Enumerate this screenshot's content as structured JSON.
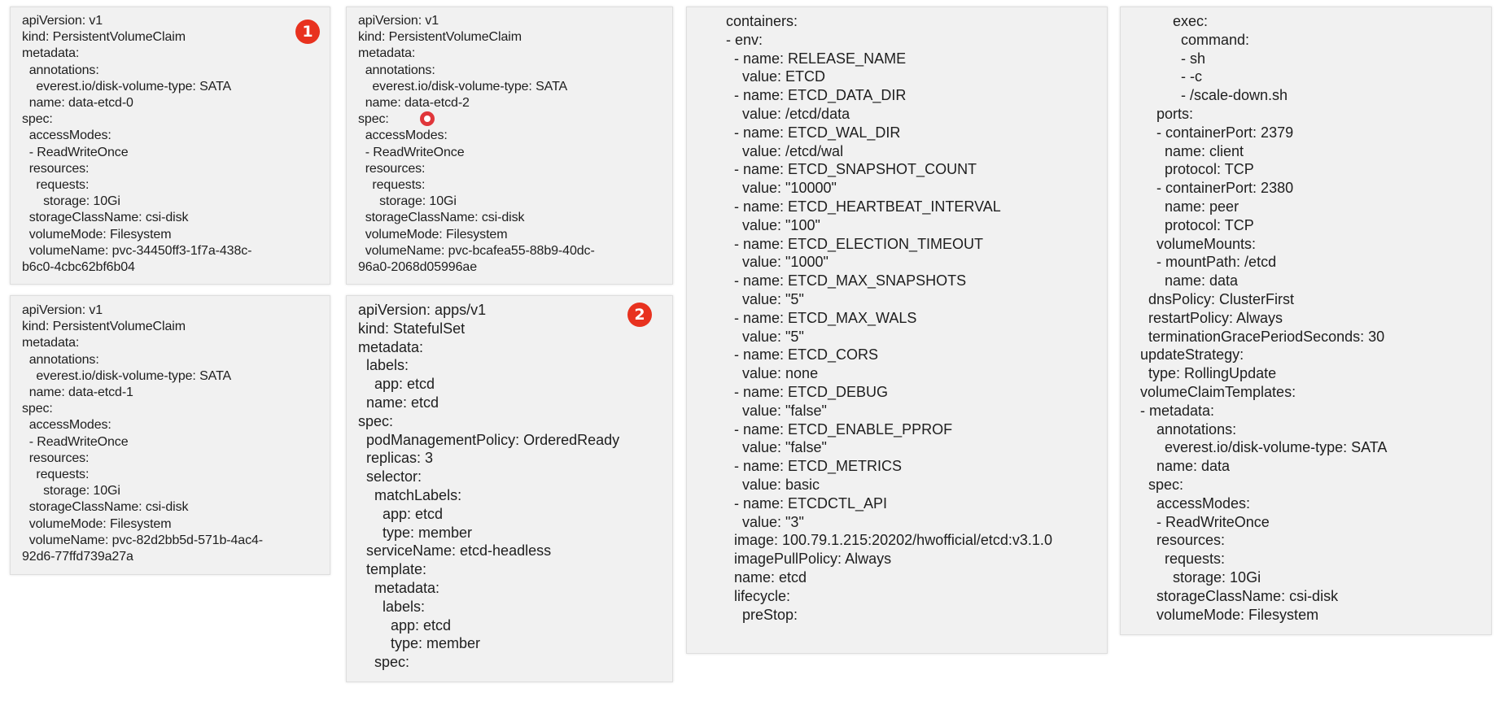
{
  "badges": {
    "one": "1",
    "two": "2"
  },
  "colors": {
    "badge": "#e8321f",
    "panel": "#f1f1f1"
  },
  "pvc0": [
    "apiVersion: v1",
    "kind: PersistentVolumeClaim",
    "metadata:",
    "  annotations:",
    "    everest.io/disk-volume-type: SATA",
    "  name: data-etcd-0",
    "spec:",
    "  accessModes:",
    "  - ReadWriteOnce",
    "  resources:",
    "    requests:",
    "      storage: 10Gi",
    "  storageClassName: csi-disk",
    "  volumeMode: Filesystem",
    "  volumeName: pvc-34450ff3-1f7a-438c-",
    "b6c0-4cbc62bf6b04"
  ],
  "pvc2": [
    "apiVersion: v1",
    "kind: PersistentVolumeClaim",
    "metadata:",
    "  annotations:",
    "    everest.io/disk-volume-type: SATA",
    "  name: data-etcd-2",
    "spec:",
    "  accessModes:",
    "  - ReadWriteOnce",
    "  resources:",
    "    requests:",
    "      storage: 10Gi",
    "  storageClassName: csi-disk",
    "  volumeMode: Filesystem",
    "  volumeName: pvc-bcafea55-88b9-40dc-",
    "96a0-2068d05996ae"
  ],
  "pvc1": [
    "apiVersion: v1",
    "kind: PersistentVolumeClaim",
    "metadata:",
    "  annotations:",
    "    everest.io/disk-volume-type: SATA",
    "  name: data-etcd-1",
    "spec:",
    "  accessModes:",
    "  - ReadWriteOnce",
    "  resources:",
    "    requests:",
    "      storage: 10Gi",
    "  storageClassName: csi-disk",
    "  volumeMode: Filesystem",
    "  volumeName: pvc-82d2bb5d-571b-4ac4-",
    "92d6-77ffd739a27a"
  ],
  "statefulset": [
    "apiVersion: apps/v1",
    "kind: StatefulSet",
    "metadata:",
    "  labels:",
    "    app: etcd",
    "  name: etcd",
    "spec:",
    "  podManagementPolicy: OrderedReady",
    "  replicas: 3",
    "  selector:",
    "    matchLabels:",
    "      app: etcd",
    "      type: member",
    "  serviceName: etcd-headless",
    "  template:",
    "    metadata:",
    "      labels:",
    "        app: etcd",
    "        type: member",
    "    spec:"
  ],
  "containers": [
    "containers:",
    "- env:",
    "  - name: RELEASE_NAME",
    "    value: ETCD",
    "  - name: ETCD_DATA_DIR",
    "    value: /etcd/data",
    "  - name: ETCD_WAL_DIR",
    "    value: /etcd/wal",
    "  - name: ETCD_SNAPSHOT_COUNT",
    "    value: \"10000\"",
    "  - name: ETCD_HEARTBEAT_INTERVAL",
    "    value: \"100\"",
    "  - name: ETCD_ELECTION_TIMEOUT",
    "    value: \"1000\"",
    "  - name: ETCD_MAX_SNAPSHOTS",
    "    value: \"5\"",
    "  - name: ETCD_MAX_WALS",
    "    value: \"5\"",
    "  - name: ETCD_CORS",
    "    value: none",
    "  - name: ETCD_DEBUG",
    "    value: \"false\"",
    "  - name: ETCD_ENABLE_PPROF",
    "    value: \"false\"",
    "  - name: ETCD_METRICS",
    "    value: basic",
    "  - name: ETCDCTL_API",
    "    value: \"3\"",
    "  image: 100.79.1.215:20202/hwofficial/etcd:v3.1.0",
    "  imagePullPolicy: Always",
    "  name: etcd",
    "  lifecycle:",
    "    preStop:"
  ],
  "exec": [
    "        exec:",
    "          command:",
    "          - sh",
    "          - -c",
    "          - /scale-down.sh",
    "    ports:",
    "    - containerPort: 2379",
    "      name: client",
    "      protocol: TCP",
    "    - containerPort: 2380",
    "      name: peer",
    "      protocol: TCP",
    "    volumeMounts:",
    "    - mountPath: /etcd",
    "      name: data",
    "  dnsPolicy: ClusterFirst",
    "  restartPolicy: Always",
    "  terminationGracePeriodSeconds: 30",
    "updateStrategy:",
    "  type: RollingUpdate",
    "volumeClaimTemplates:",
    "- metadata:",
    "    annotations:",
    "      everest.io/disk-volume-type: SATA",
    "    name: data",
    "  spec:",
    "    accessModes:",
    "    - ReadWriteOnce",
    "    resources:",
    "      requests:",
    "        storage: 10Gi",
    "    storageClassName: csi-disk",
    "    volumeMode: Filesystem"
  ]
}
